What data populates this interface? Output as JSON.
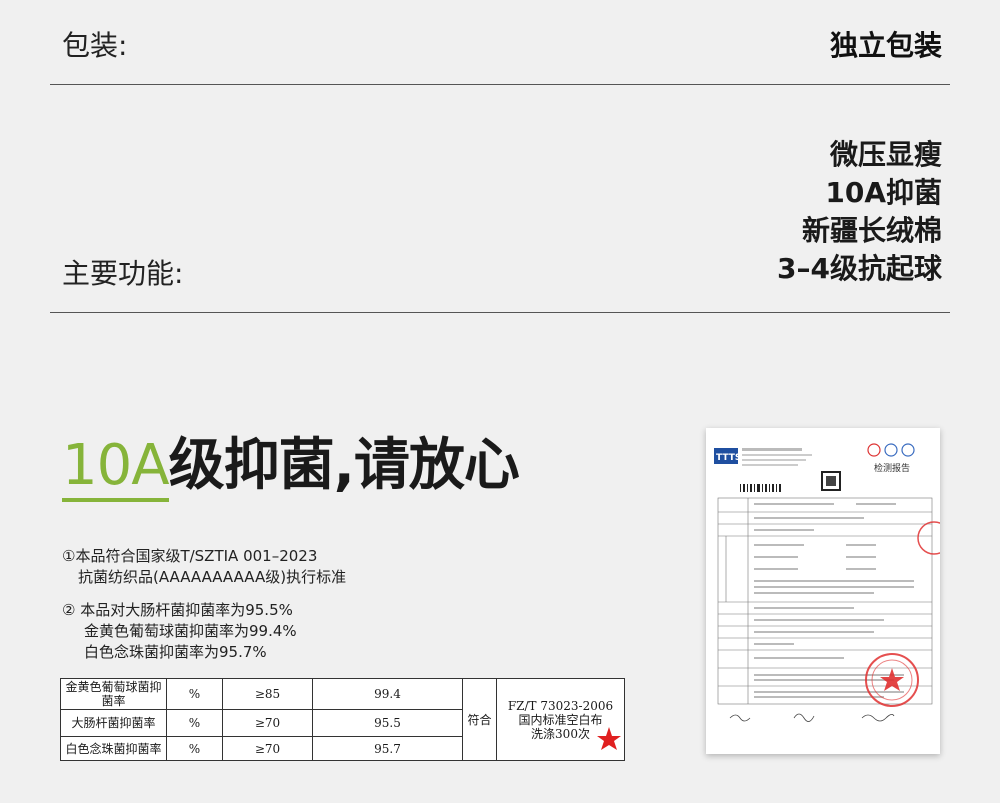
{
  "rows": {
    "packaging": {
      "label": "包装:",
      "value": "独立包装"
    },
    "functions": {
      "label": "主要功能:",
      "items": [
        "微压显瘦",
        "10A抑菌",
        "新疆长绒棉",
        "3–4级抗起球"
      ]
    }
  },
  "heading": {
    "accent": "10A",
    "rest": "级抑菌,请放心"
  },
  "notes": {
    "note1": [
      "①本品符合国家级T/SZTIA 001–2023",
      "抗菌纺织品(AAAAAAAAAA级)执行标准"
    ],
    "note2": [
      "② 本品对大肠杆菌抑菌率为95.5%",
      "金黄色葡萄球菌抑菌率为99.4%",
      "白色念珠菌抑菌率为95.7%"
    ]
  },
  "table": {
    "rows": [
      {
        "name": "金黄色葡萄球菌抑菌率",
        "unit": "%",
        "req": "≥85",
        "value": "99.4"
      },
      {
        "name": "大肠杆菌抑菌率",
        "unit": "%",
        "req": "≥70",
        "value": "95.5"
      },
      {
        "name": "白色念珠菌抑菌率",
        "unit": "%",
        "req": "≥70",
        "value": "95.7"
      }
    ],
    "verdict": "符合",
    "standard": [
      "FZ/T 73023-2006",
      "国内标准空白布",
      "洗涤300次"
    ]
  },
  "report": {
    "logo": "TTTS",
    "title": "检测报告"
  },
  "colors": {
    "accent": "#86b43a",
    "stamp": "#e02020"
  }
}
